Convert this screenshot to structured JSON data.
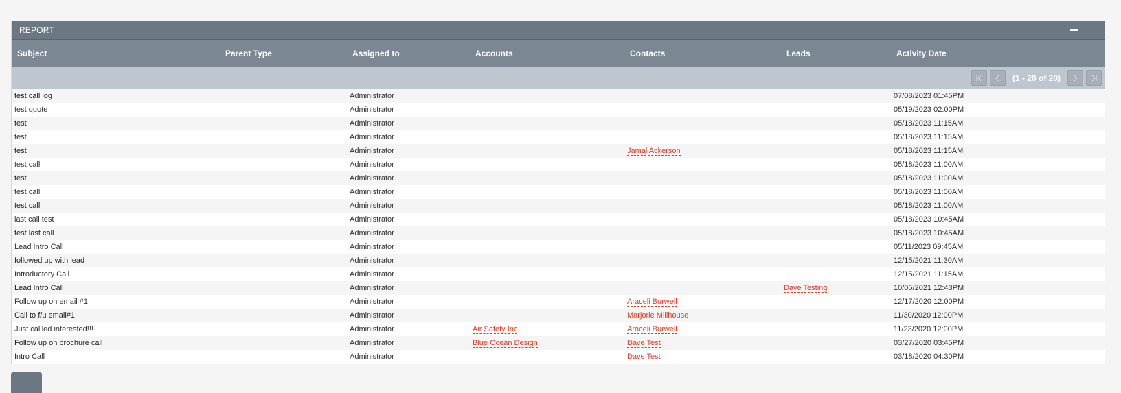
{
  "panel": {
    "title": "REPORT"
  },
  "columns": [
    "Subject",
    "Parent Type",
    "Assigned to",
    "Accounts",
    "Contacts",
    "Leads",
    "Activity Date"
  ],
  "pager": {
    "count": "(1 - 20 of 20)"
  },
  "rows": [
    {
      "subject": "test call log",
      "parent_type": "",
      "assigned": "Administrator",
      "account": "",
      "contact": "",
      "lead": "",
      "date": "07/08/2023 01:45PM"
    },
    {
      "subject": "test quote",
      "parent_type": "",
      "assigned": "Administrator",
      "account": "",
      "contact": "",
      "lead": "",
      "date": "05/19/2023 02:00PM"
    },
    {
      "subject": "test",
      "parent_type": "",
      "assigned": "Administrator",
      "account": "",
      "contact": "",
      "lead": "",
      "date": "05/18/2023 11:15AM"
    },
    {
      "subject": "test",
      "parent_type": "",
      "assigned": "Administrator",
      "account": "",
      "contact": "",
      "lead": "",
      "date": "05/18/2023 11:15AM"
    },
    {
      "subject": "test",
      "parent_type": "",
      "assigned": "Administrator",
      "account": "",
      "contact": "Jamal Ackerson",
      "lead": "",
      "date": "05/18/2023 11:15AM"
    },
    {
      "subject": "test call",
      "parent_type": "",
      "assigned": "Administrator",
      "account": "",
      "contact": "",
      "lead": "",
      "date": "05/18/2023 11:00AM"
    },
    {
      "subject": "test",
      "parent_type": "",
      "assigned": "Administrator",
      "account": "",
      "contact": "",
      "lead": "",
      "date": "05/18/2023 11:00AM"
    },
    {
      "subject": "test call",
      "parent_type": "",
      "assigned": "Administrator",
      "account": "",
      "contact": "",
      "lead": "",
      "date": "05/18/2023 11:00AM"
    },
    {
      "subject": "test call",
      "parent_type": "",
      "assigned": "Administrator",
      "account": "",
      "contact": "",
      "lead": "",
      "date": "05/18/2023 11:00AM"
    },
    {
      "subject": "last call test",
      "parent_type": "",
      "assigned": "Administrator",
      "account": "",
      "contact": "",
      "lead": "",
      "date": "05/18/2023 10:45AM"
    },
    {
      "subject": "test last call",
      "parent_type": "",
      "assigned": "Administrator",
      "account": "",
      "contact": "",
      "lead": "",
      "date": "05/18/2023 10:45AM"
    },
    {
      "subject": "Lead Intro Call",
      "parent_type": "",
      "assigned": "Administrator",
      "account": "",
      "contact": "",
      "lead": "",
      "date": "05/11/2023 09:45AM"
    },
    {
      "subject": "followed up with lead",
      "parent_type": "",
      "assigned": "Administrator",
      "account": "",
      "contact": "",
      "lead": "",
      "date": "12/15/2021 11:30AM"
    },
    {
      "subject": "Introductory Call",
      "parent_type": "",
      "assigned": "Administrator",
      "account": "",
      "contact": "",
      "lead": "",
      "date": "12/15/2021 11:15AM"
    },
    {
      "subject": "Lead Intro Call",
      "parent_type": "",
      "assigned": "Administrator",
      "account": "",
      "contact": "",
      "lead": "Dave Testing",
      "date": "10/05/2021 12:43PM"
    },
    {
      "subject": "Follow up on email #1",
      "parent_type": "",
      "assigned": "Administrator",
      "account": "",
      "contact": "Araceli Burwell",
      "lead": "",
      "date": "12/17/2020 12:00PM"
    },
    {
      "subject": "Call to f/u email#1",
      "parent_type": "",
      "assigned": "Administrator",
      "account": "",
      "contact": "Marjorie Millhouse",
      "lead": "",
      "date": "11/30/2020 12:00PM"
    },
    {
      "subject": "Just callled interested!!!",
      "parent_type": "",
      "assigned": "Administrator",
      "account": "Air Safety Inc",
      "contact": "Araceli Burwell",
      "lead": "",
      "date": "11/23/2020 12:00PM"
    },
    {
      "subject": "Follow up on brochure call",
      "parent_type": "",
      "assigned": "Administrator",
      "account": "Blue Ocean Design",
      "contact": "Dave Test",
      "lead": "",
      "date": "03/27/2020 03:45PM"
    },
    {
      "subject": "Intro Call",
      "parent_type": "",
      "assigned": "Administrator",
      "account": "",
      "contact": "Dave Test",
      "lead": "",
      "date": "03/18/2020 04:30PM"
    }
  ],
  "colors": {
    "header": "#6b7782",
    "column_header": "#7b8893",
    "pager_bar": "#bdc7d0",
    "link": "#e0412c"
  },
  "icons": {
    "collapse": "minus-icon",
    "first": "first-page-icon",
    "prev": "prev-page-icon",
    "next": "next-page-icon",
    "last": "last-page-icon"
  }
}
